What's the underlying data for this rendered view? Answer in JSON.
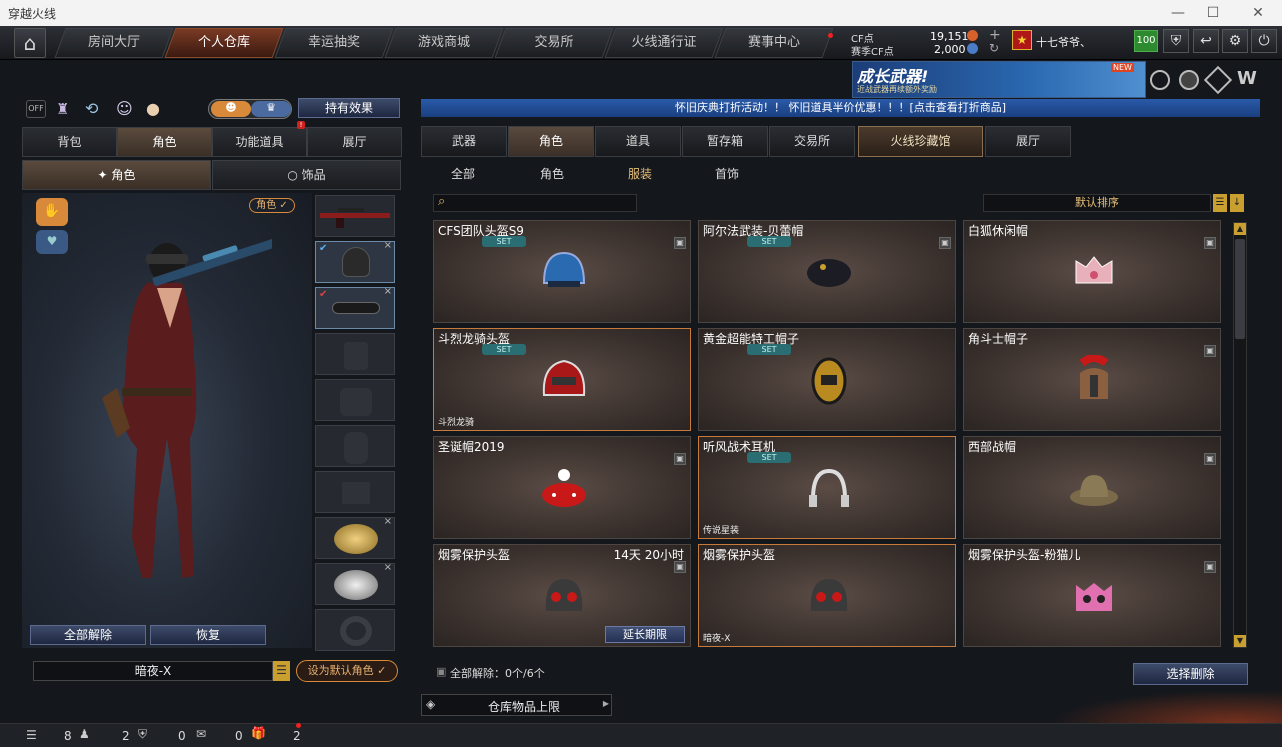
{
  "window": {
    "title": "穿越火线"
  },
  "nav": {
    "tabs": [
      "房间大厅",
      "个人仓库",
      "幸运抽奖",
      "游戏商城",
      "交易所",
      "火线通行证",
      "赛事中心"
    ],
    "active": 1
  },
  "currency": {
    "cf_label": "CF点",
    "cf_value": "19,151",
    "season_label": "赛季CF点",
    "season_value": "2,000"
  },
  "user": {
    "name": "十七爷爷、",
    "level": "100"
  },
  "banner": {
    "title": "成长武器!",
    "subtitle": "近战武器再续额外奖励",
    "badge": "NEW"
  },
  "announcement": "怀旧庆典打折活动！！ 怀旧道具半价优惠！！！[点击查看打折商品]",
  "left": {
    "effect_button": "持有效果",
    "toggle_off": "OFF",
    "tabs": [
      "背包",
      "角色",
      "功能道具",
      "展厅"
    ],
    "active_tab": 1,
    "subtabs": [
      "角色",
      "饰品"
    ],
    "role_badge": "角色",
    "buttons": {
      "unequip_all": "全部解除",
      "restore": "恢复"
    },
    "character_name": "暗夜-X",
    "set_default": "设为默认角色"
  },
  "right": {
    "tabs": [
      "武器",
      "角色",
      "道具",
      "暂存箱",
      "交易所",
      "火线珍藏馆",
      "展厅"
    ],
    "active_tab": 1,
    "subtabs": [
      "全部",
      "角色",
      "服装",
      "首饰"
    ],
    "active_subtab": 2,
    "sort_label": "默认排序",
    "items": [
      {
        "name": "CFS团队头盔S9",
        "set": "SET",
        "tag": "",
        "time": "",
        "icon": "blue-helmet-icon"
      },
      {
        "name": "阿尔法武装-贝蕾帽",
        "set": "SET",
        "tag": "",
        "time": "",
        "icon": "beret-icon"
      },
      {
        "name": "白狐休闲帽",
        "set": "",
        "tag": "",
        "time": "",
        "icon": "fox-cap-icon"
      },
      {
        "name": "斗烈龙骑头盔",
        "set": "SET",
        "tag": "斗烈龙骑",
        "time": "",
        "icon": "dragon-helmet-icon"
      },
      {
        "name": "黄金超能特工帽子",
        "set": "SET",
        "tag": "",
        "time": "",
        "icon": "gold-hood-icon"
      },
      {
        "name": "角斗士帽子",
        "set": "",
        "tag": "",
        "time": "",
        "icon": "gladiator-helmet-icon"
      },
      {
        "name": "圣诞帽2019",
        "set": "",
        "tag": "",
        "time": "",
        "icon": "christmas-hat-icon"
      },
      {
        "name": "听风战术耳机",
        "set": "SET",
        "tag": "传说星装",
        "time": "",
        "icon": "headphones-icon"
      },
      {
        "name": "西部战帽",
        "set": "",
        "tag": "",
        "time": "",
        "icon": "boonie-hat-icon"
      },
      {
        "name": "烟雾保护头盔",
        "set": "",
        "tag": "",
        "time": "14天 20小时",
        "icon": "gas-helmet-icon",
        "extend": "延长期限"
      },
      {
        "name": "烟雾保护头盔",
        "set": "",
        "tag": "暗夜-X",
        "time": "",
        "icon": "gas-helmet-icon"
      },
      {
        "name": "烟雾保护头盔-粉猫儿",
        "set": "",
        "tag": "",
        "time": "",
        "icon": "pink-cat-helmet-icon"
      }
    ],
    "unequip_status": "全部解除：0个/6个",
    "select_delete": "选择删除",
    "storage_limit": "仓库物品上限"
  },
  "status": {
    "count1": "8",
    "count2": "2",
    "count3": "0",
    "count4": "0",
    "count5": "2"
  }
}
